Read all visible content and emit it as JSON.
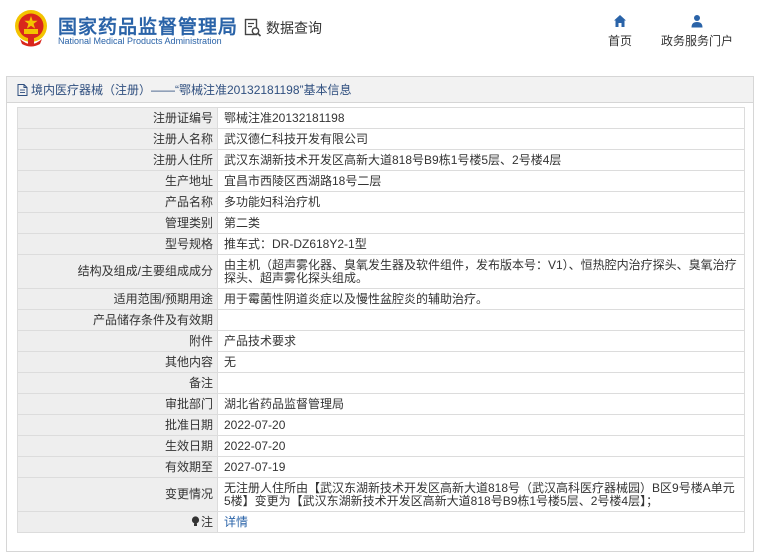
{
  "header": {
    "brand_cn": "国家药品监督管理局",
    "brand_en": "National Medical Products Administration",
    "query_label": "数据查询",
    "nav": [
      {
        "label": "首页",
        "icon": "home-icon"
      },
      {
        "label": "政务服务门户",
        "icon": "user-icon"
      }
    ]
  },
  "panel": {
    "title": "境内医疗器械（注册）——“鄂械注准20132181198”基本信息"
  },
  "details": [
    {
      "label": "注册证编号",
      "value": "鄂械注准20132181198"
    },
    {
      "label": "注册人名称",
      "value": "武汉德仁科技开发有限公司"
    },
    {
      "label": "注册人住所",
      "value": "武汉东湖新技术开发区高新大道818号B9栋1号楼5层、2号楼4层"
    },
    {
      "label": "生产地址",
      "value": "宜昌市西陵区西湖路18号二层"
    },
    {
      "label": "产品名称",
      "value": "多功能妇科治疗机"
    },
    {
      "label": "管理类别",
      "value": "第二类"
    },
    {
      "label": "型号规格",
      "value": "推车式：DR-DZ618Y2-1型"
    },
    {
      "label": "结构及组成/主要组成成分",
      "value": "由主机（超声雾化器、臭氧发生器及软件组件，发布版本号：V1）、恒热腔内治疗探头、臭氧治疗探头、超声雾化探头组成。"
    },
    {
      "label": "适用范围/预期用途",
      "value": "用于霉菌性阴道炎症以及慢性盆腔炎的辅助治疗。"
    },
    {
      "label": "产品储存条件及有效期",
      "value": ""
    },
    {
      "label": "附件",
      "value": "产品技术要求"
    },
    {
      "label": "其他内容",
      "value": "无"
    },
    {
      "label": "备注",
      "value": ""
    },
    {
      "label": "审批部门",
      "value": "湖北省药品监督管理局"
    },
    {
      "label": "批准日期",
      "value": "2022-07-20"
    },
    {
      "label": "生效日期",
      "value": "2022-07-20"
    },
    {
      "label": "有效期至",
      "value": "2027-07-19"
    },
    {
      "label": "变更情况",
      "value": "无注册人住所由【武汉东湖新技术开发区高新大道818号（武汉高科医疗器械园）B区9号楼A单元5楼】变更为【武汉东湖新技术开发区高新大道818号B9栋1号楼5层、2号楼4层】；"
    }
  ],
  "note": {
    "label": "注",
    "link": "详情"
  },
  "colors": {
    "brand_blue": "#2a63a8",
    "emblem_red": "#d9261c",
    "emblem_gold": "#f3c300",
    "label_bg": "#eeeeee"
  }
}
